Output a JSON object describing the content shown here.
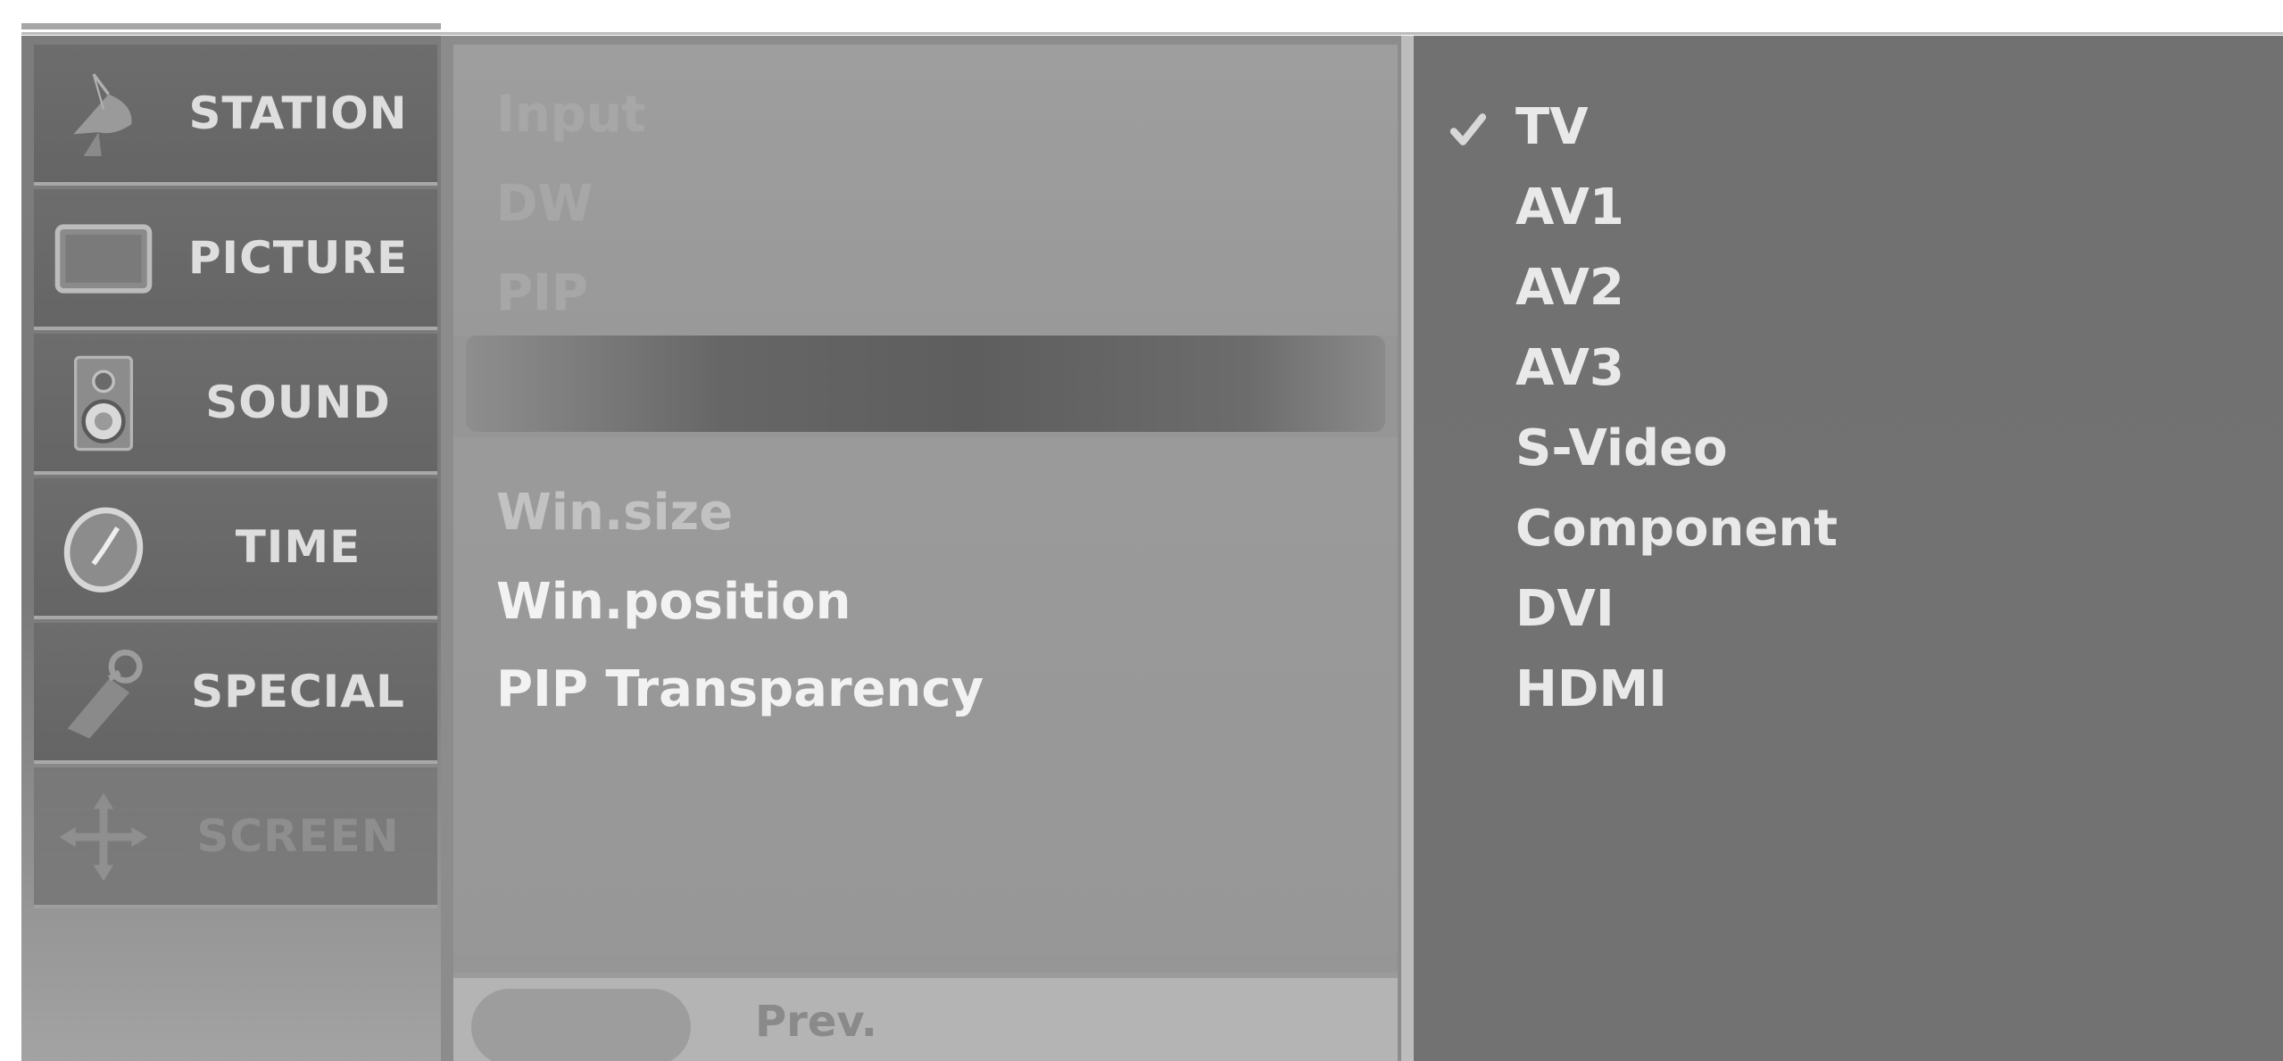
{
  "categories": [
    {
      "label": "STATION",
      "icon": "satellite-dish-icon",
      "enabled": true
    },
    {
      "label": "PICTURE",
      "icon": "tv-screen-icon",
      "enabled": true
    },
    {
      "label": "SOUND",
      "icon": "speaker-icon",
      "enabled": true
    },
    {
      "label": "TIME",
      "icon": "clock-icon",
      "enabled": true
    },
    {
      "label": "SPECIAL",
      "icon": "tag-icon",
      "enabled": true
    },
    {
      "label": "SCREEN",
      "icon": "crosshair-arrows-icon",
      "enabled": false
    }
  ],
  "submenu": {
    "items_faded": [
      "Input",
      "DW",
      "PIP"
    ],
    "items_lower": [
      {
        "label": "Win.size",
        "state": "disabled"
      },
      {
        "label": "Win.position",
        "state": "active"
      },
      {
        "label": "PIP Transparency",
        "state": "active"
      }
    ],
    "footer": {
      "prev_label": "Prev."
    }
  },
  "options": {
    "items": [
      "TV",
      "AV1",
      "AV2",
      "AV3",
      "S-Video",
      "Component",
      "DVI",
      "HDMI"
    ],
    "selected": "TV"
  },
  "colors": {
    "osd_background": "#8c8c8c",
    "category_tile": "#6a6a6a",
    "options_panel": "#727272",
    "text_light": "#e9e9e9"
  }
}
